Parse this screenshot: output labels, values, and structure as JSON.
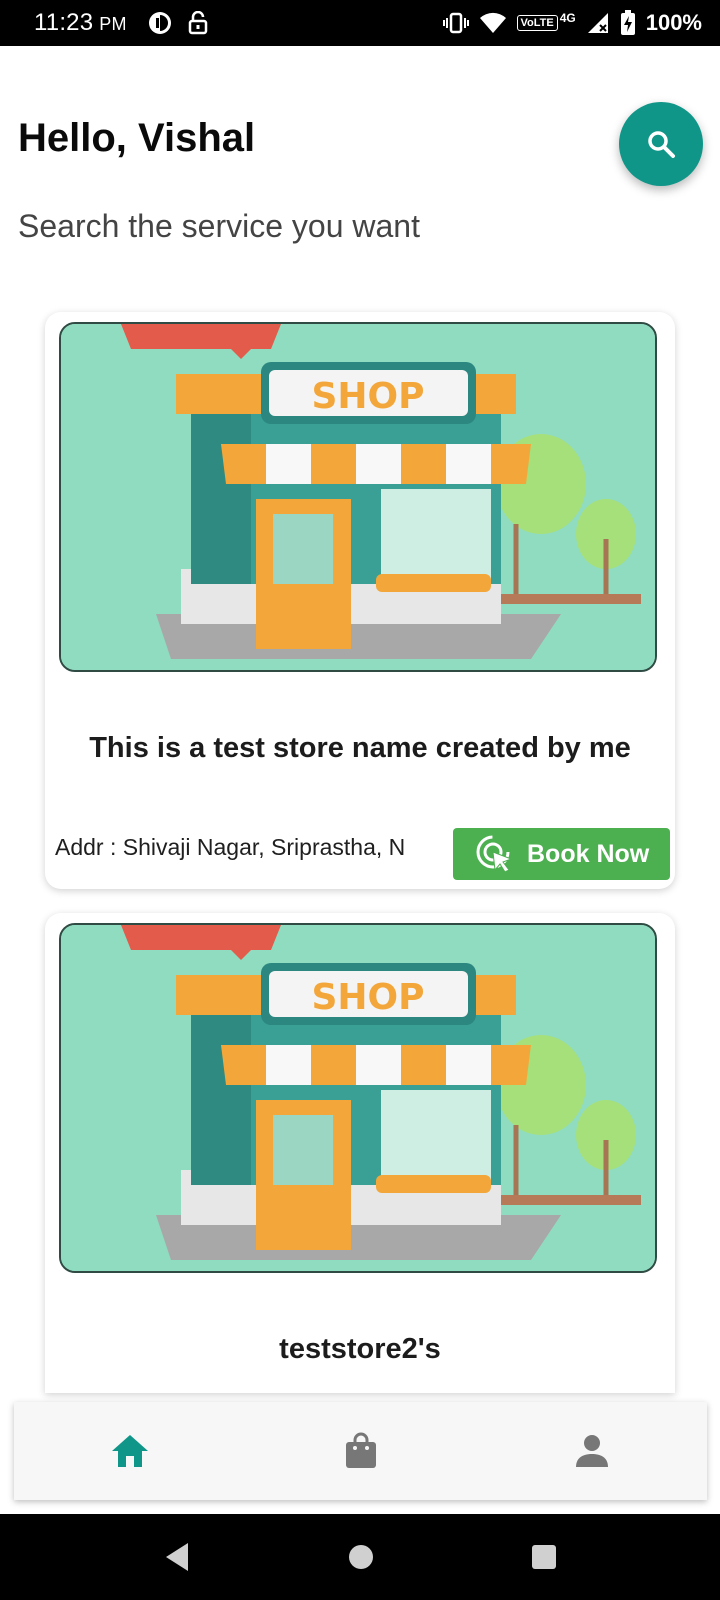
{
  "status_bar": {
    "time": "11:23",
    "meridiem": "PM",
    "network_label": "VoLTE",
    "network_type": "4G",
    "battery": "100%"
  },
  "header": {
    "greeting": "Hello, Vishal",
    "subtitle": "Search the service you want",
    "search_icon": "search-icon"
  },
  "stores": [
    {
      "name": "This is a test store name created by me",
      "address": "Addr : Shivaji Nagar, Sriprastha, N",
      "book_label": "Book Now",
      "image_text": "SHOP"
    },
    {
      "name": "teststore2's",
      "image_text": "SHOP"
    }
  ],
  "bottom_nav": {
    "items": [
      "home-icon",
      "shopping-bag-icon",
      "person-icon"
    ],
    "active": "home-icon"
  },
  "colors": {
    "accent": "#0f9688",
    "book_button": "#4caf50",
    "inactive_icon": "#777777"
  }
}
